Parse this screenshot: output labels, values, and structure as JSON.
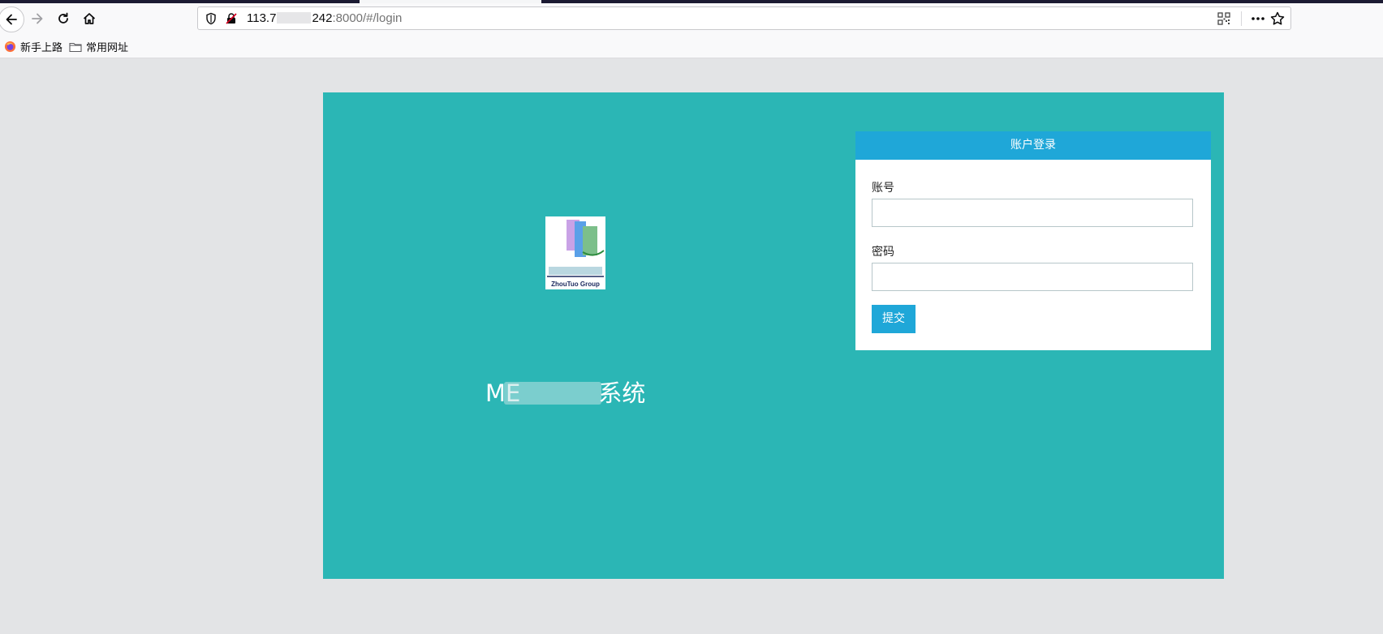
{
  "browser": {
    "url": {
      "prefix": "113.7",
      "middle": "242",
      "suffix": ":8000/#/login"
    },
    "icons": {
      "back": "back-arrow-icon",
      "forward": "forward-arrow-icon",
      "reload": "reload-icon",
      "home": "home-icon",
      "page_info": "shield-icon",
      "insecure": "insecure-lock-icon",
      "qr": "qr-code-icon",
      "more": "more-dots-icon",
      "bookmark": "star-icon"
    },
    "bookmarks": [
      {
        "label": "新手上路",
        "icon": "firefox-icon"
      },
      {
        "label": "常用网址",
        "icon": "folder-icon"
      }
    ]
  },
  "page": {
    "logo_text": "ZhouTuo Group",
    "system_title": {
      "start": "ME",
      "end": "系统"
    },
    "login": {
      "header": "账户登录",
      "username_label": "账号",
      "username_value": "",
      "password_label": "密码",
      "password_value": "",
      "submit_label": "提交"
    }
  },
  "colors": {
    "panel": "#2bb6b5",
    "accent": "#1fa7d8",
    "page_bg": "#e3e4e6"
  }
}
